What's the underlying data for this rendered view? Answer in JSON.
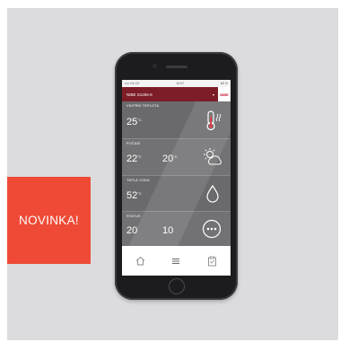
{
  "badge": {
    "label": "NOVINKA!"
  },
  "phone": {
    "status": {
      "carrier": "•••• O2-CZ",
      "time": "10:37",
      "battery": "80 %"
    },
    "header": {
      "device": "NIBE S1255-6",
      "brand": "NIBE"
    },
    "sections": [
      {
        "label": "VNITŘNÍ TEPLOTA",
        "value": "25",
        "unit": "°C",
        "icon": "thermometer-icon"
      },
      {
        "label": "POČASÍ",
        "value1": "22",
        "unit1": "°C",
        "value2": "20",
        "unit2": "°C",
        "icon": "weather-icon"
      },
      {
        "label": "TEPLÁ VODA",
        "value": "52",
        "unit": "°C",
        "icon": "water-drop-icon"
      },
      {
        "label": "STATUS",
        "value1": "20",
        "value2": "10",
        "icon": "more-icon"
      }
    ],
    "nav": [
      "home-icon",
      "menu-icon",
      "clipboard-icon"
    ]
  },
  "colors": {
    "header": "#7c1d27",
    "badge": "#ef4a36",
    "screen": "#6e6e70"
  }
}
